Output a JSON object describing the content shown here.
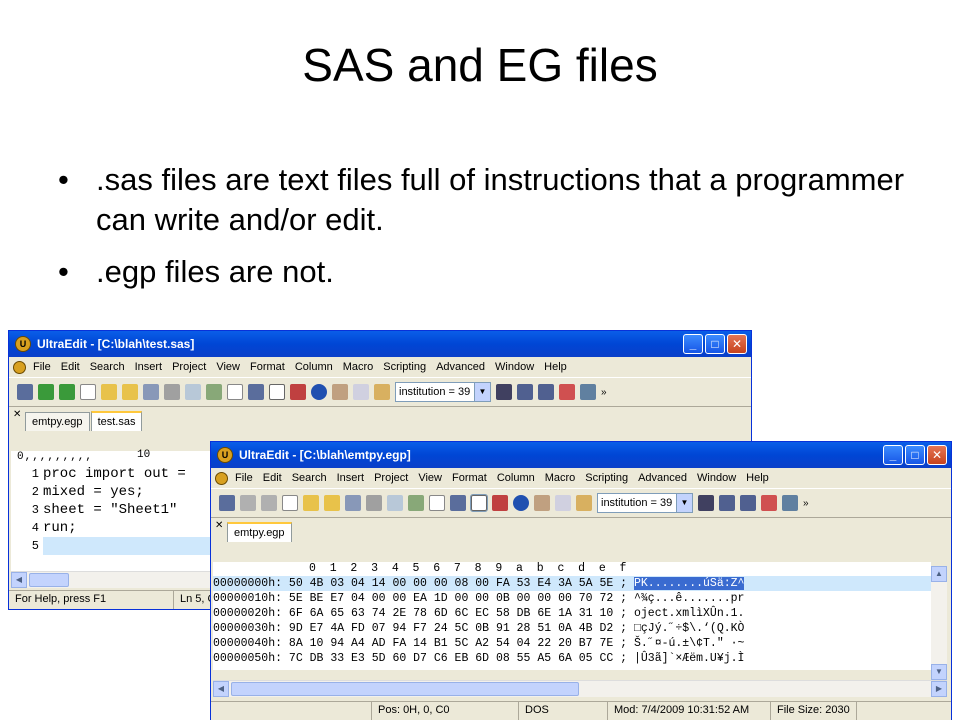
{
  "slide": {
    "title": "SAS and EG files",
    "bullets": [
      ".sas files are text files full of instructions that a programmer can write and/or edit.",
      ".egp files are not."
    ]
  },
  "menu_items": [
    "File",
    "Edit",
    "Search",
    "Insert",
    "Project",
    "View",
    "Format",
    "Column",
    "Macro",
    "Scripting",
    "Advanced",
    "Window",
    "Help"
  ],
  "window1": {
    "title": "UltraEdit - [C:\\blah\\test.sas]",
    "combo_value": "institution = 39",
    "tabs": [
      "emtpy.egp",
      "test.sas"
    ],
    "active_tab": "test.sas",
    "ruler_label": "10",
    "code_lines": [
      {
        "num": "1",
        "text": "proc import out ="
      },
      {
        "num": "2",
        "text": "mixed = yes;"
      },
      {
        "num": "3",
        "text": "sheet = \"Sheet1\""
      },
      {
        "num": "4",
        "text": "run;"
      },
      {
        "num": "5",
        "text": ""
      }
    ],
    "status_help": "For Help, press F1",
    "status_pos": "Ln 5, C"
  },
  "window2": {
    "title": "UltraEdit - [C:\\blah\\emtpy.egp]",
    "combo_value": "institution = 39",
    "tabs": [
      "emtpy.egp"
    ],
    "active_tab": "emtpy.egp",
    "hex_header": "0  1  2  3  4  5  6  7  8  9  a  b  c  d  e  f",
    "hex_rows": [
      {
        "addr": "00000000h:",
        "bytes": "50 4B 03 04 14 00 00 00 08 00 FA 53 E4 3A 5A 5E",
        "ascii": "PK........úSä:Z^"
      },
      {
        "addr": "00000010h:",
        "bytes": "5E BE E7 04 00 00 EA 1D 00 00 0B 00 00 00 70 72",
        "ascii": "^¾ç...ê.......pr"
      },
      {
        "addr": "00000020h:",
        "bytes": "6F 6A 65 63 74 2E 78 6D 6C EC 58 DB 6E 1A 31 10",
        "ascii": "oject.xmlìXÛn.1."
      },
      {
        "addr": "00000030h:",
        "bytes": "9D E7 4A FD 07 94 F7 24 5C 0B 91 28 51 0A 4B D2",
        "ascii": "□çJý.˝÷$\\.‘(Q.KÒ"
      },
      {
        "addr": "00000040h:",
        "bytes": "8A 10 94 A4 AD FA 14 B1 5C A2 54 04 22 20 B7 7E",
        "ascii": "Š.˝¤-ú.±\\¢T.\" ·~"
      },
      {
        "addr": "00000050h:",
        "bytes": "7C DB 33 E3 5D 60 D7 C6 EB 6D 08 55 A5 6A 05 CC",
        "ascii": "|Û3ã]`×Æëm.U¥j.Ì"
      }
    ],
    "status_pos": "Pos: 0H, 0, C0",
    "status_format": "DOS",
    "status_mod": "Mod: 7/4/2009 10:31:52 AM",
    "status_size": "File Size: 2030"
  }
}
